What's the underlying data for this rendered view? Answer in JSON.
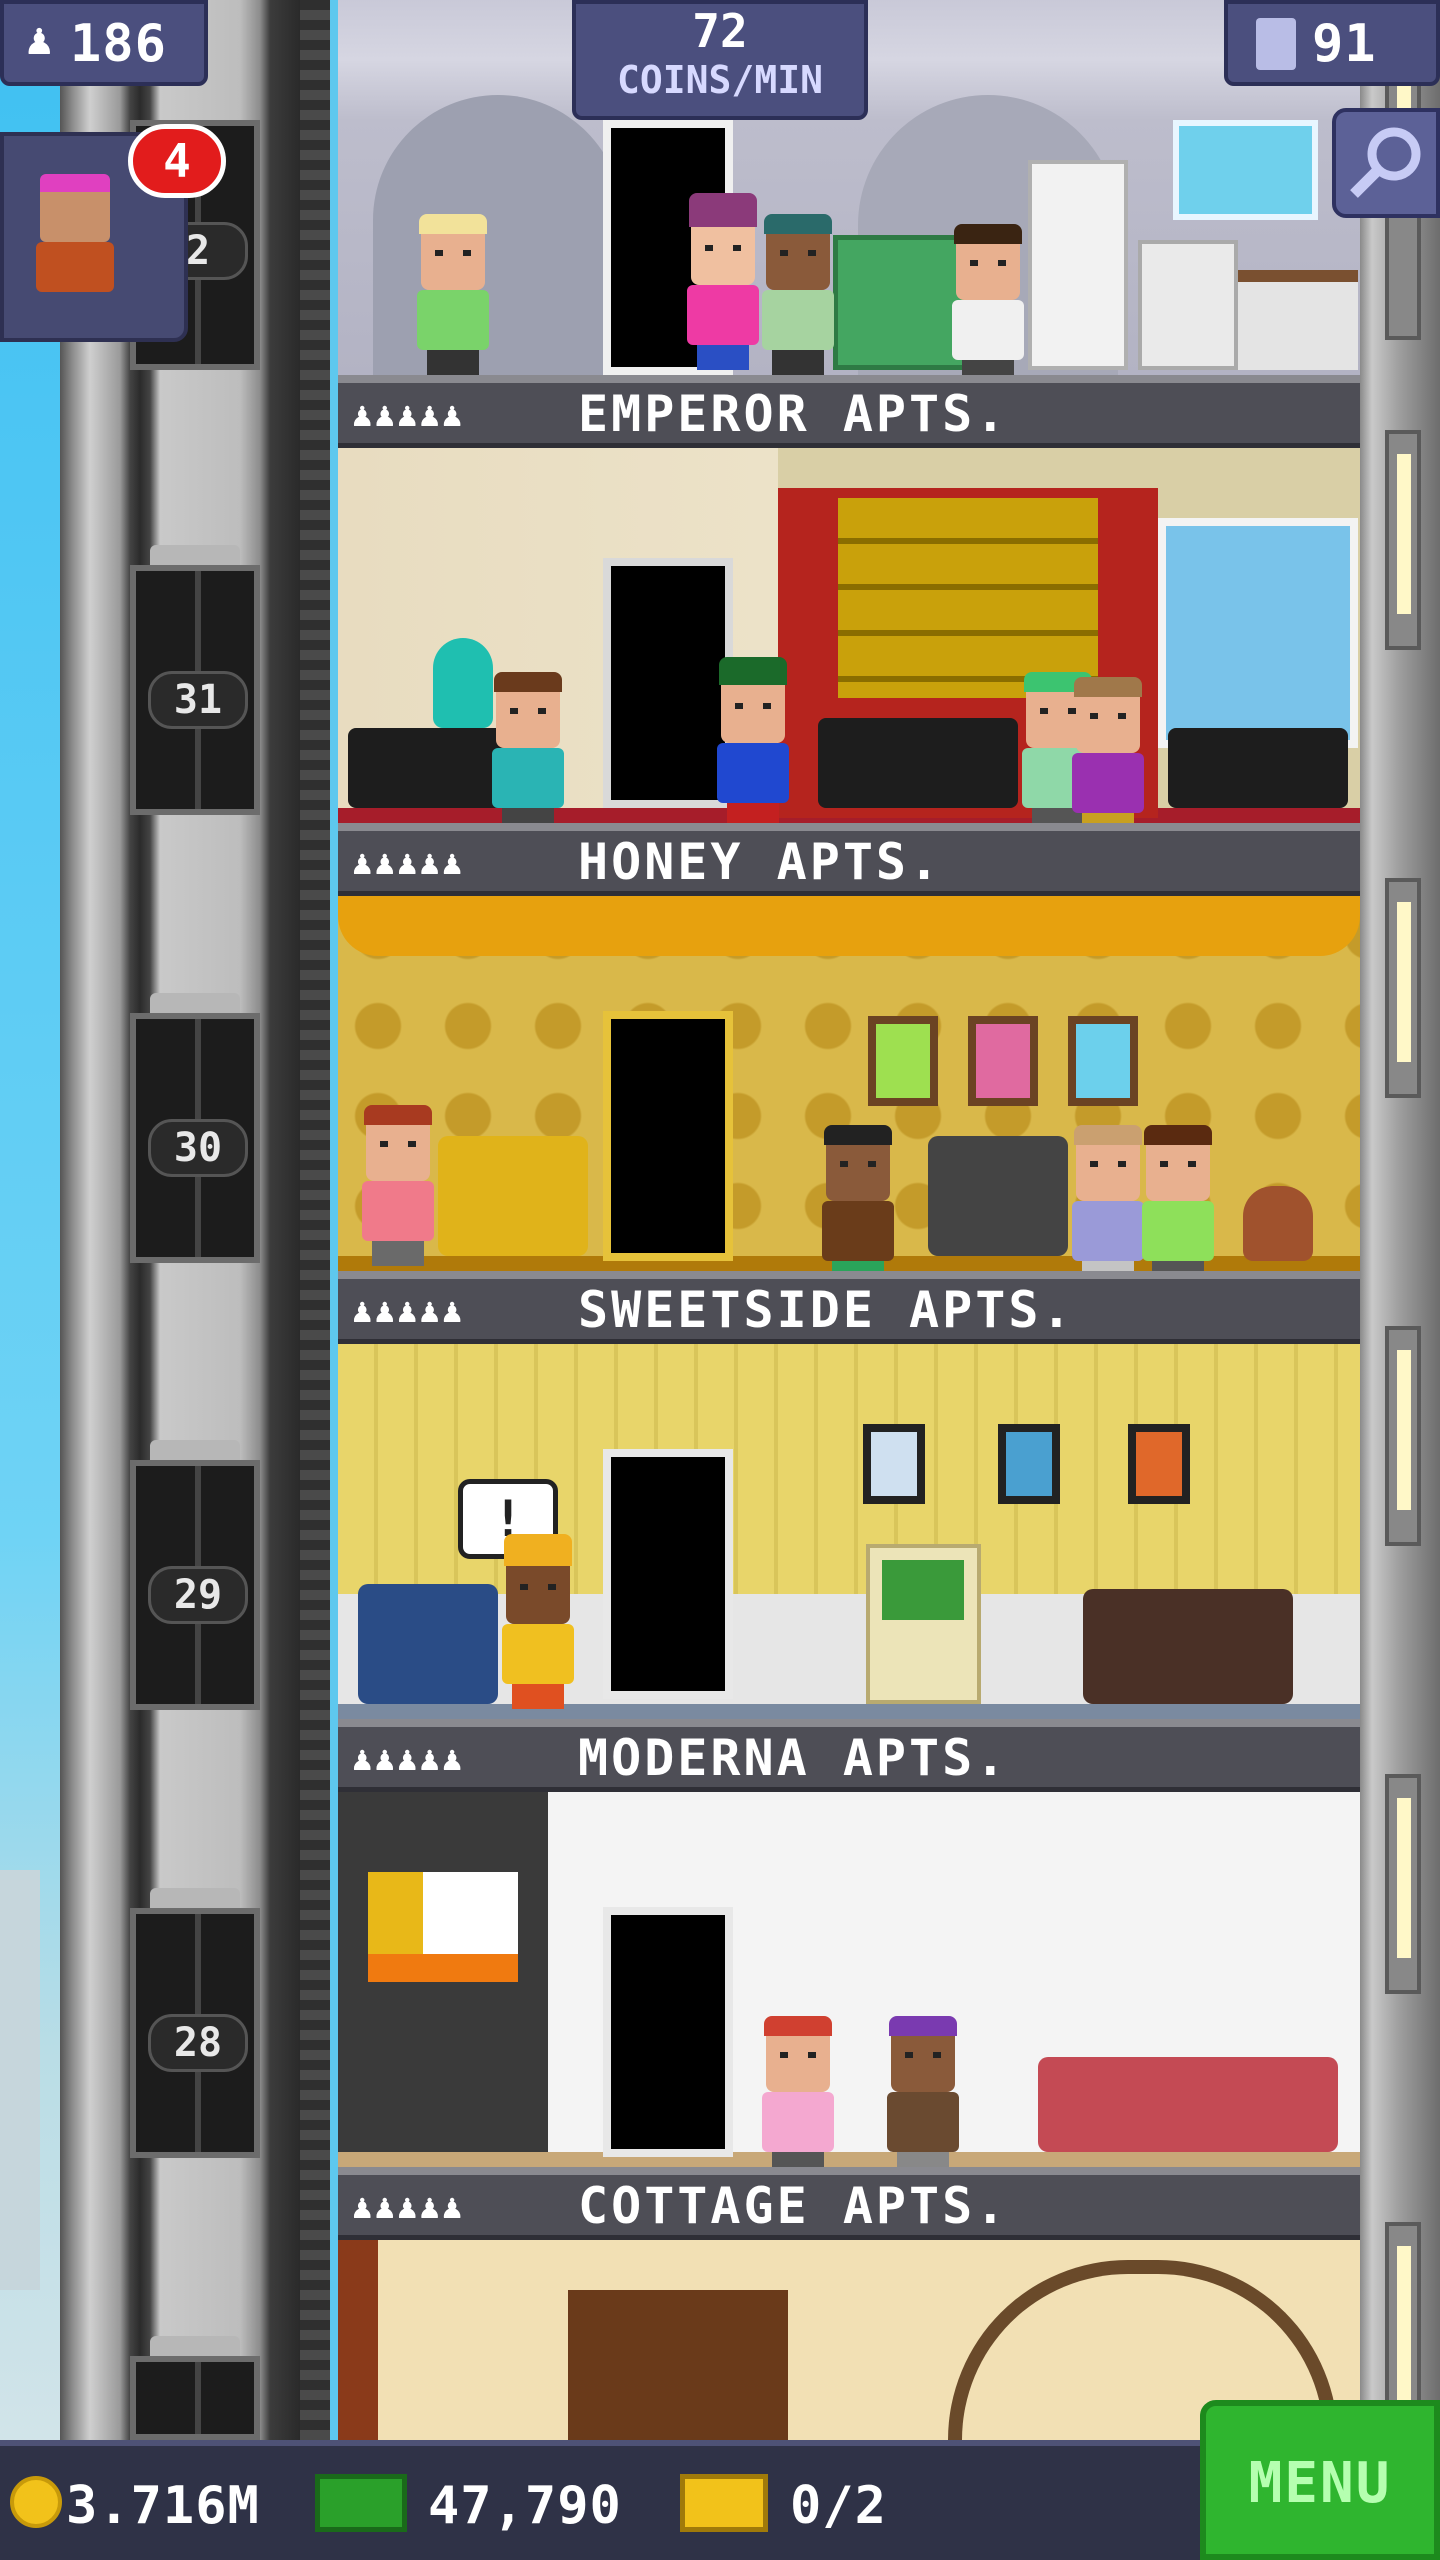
{
  "hud": {
    "population": "186",
    "coins_per_min_value": "72",
    "coins_per_min_label": "COINS/MIN",
    "floors": "91",
    "notification_count": "4"
  },
  "elevator_floor_numbers": [
    "2",
    "31",
    "30",
    "29",
    "28"
  ],
  "floors": [
    {
      "name": "EMPEROR APTS.",
      "residents_icons": "♟♟♟♟♟"
    },
    {
      "name": "HONEY APTS.",
      "residents_icons": "♟♟♟♟♟"
    },
    {
      "name": "SWEETSIDE APTS.",
      "residents_icons": "♟♟♟♟♟"
    },
    {
      "name": "MODERNA APTS.",
      "residents_icons": "♟♟♟♟♟"
    },
    {
      "name": "COTTAGE APTS.",
      "residents_icons": "♟♟♟♟♟"
    }
  ],
  "speech_bubble": "!",
  "bottom": {
    "coins": "3.716M",
    "bux": "47,790",
    "tickets": "0/2",
    "menu_label": "MENU"
  },
  "colors": {
    "hud_bg": "#4b4f7e",
    "badge": "#e21c1c",
    "menu_button": "#2fb52f",
    "honey_wall": "#d9b84a",
    "moderna_wall": "#e8d56a"
  }
}
